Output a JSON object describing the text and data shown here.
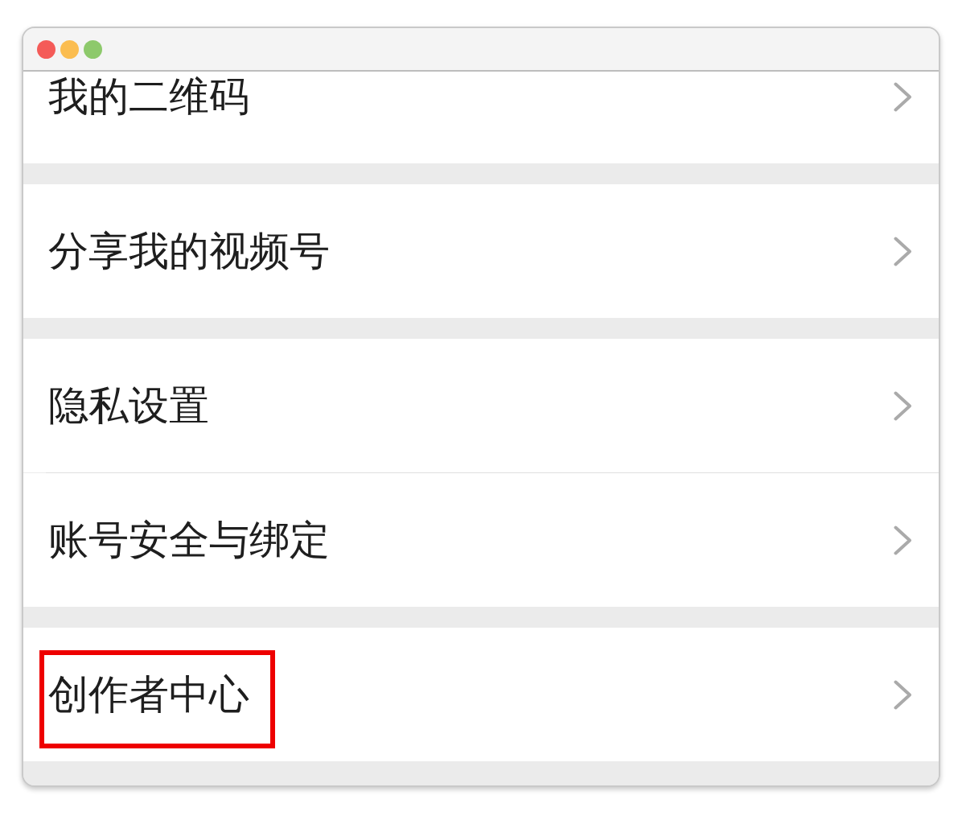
{
  "window": {
    "traffic_lights": [
      {
        "color": "#f45b58"
      },
      {
        "color": "#fbbd50"
      },
      {
        "color": "#8dc96b"
      }
    ]
  },
  "settings": {
    "groups": [
      {
        "items": [
          {
            "label": "我的二维码",
            "highlighted": false
          }
        ]
      },
      {
        "items": [
          {
            "label": "分享我的视频号",
            "highlighted": false
          }
        ]
      },
      {
        "items": [
          {
            "label": "隐私设置",
            "highlighted": false
          },
          {
            "label": "账号安全与绑定",
            "highlighted": false
          }
        ]
      },
      {
        "items": [
          {
            "label": "创作者中心",
            "highlighted": true
          }
        ]
      }
    ]
  }
}
